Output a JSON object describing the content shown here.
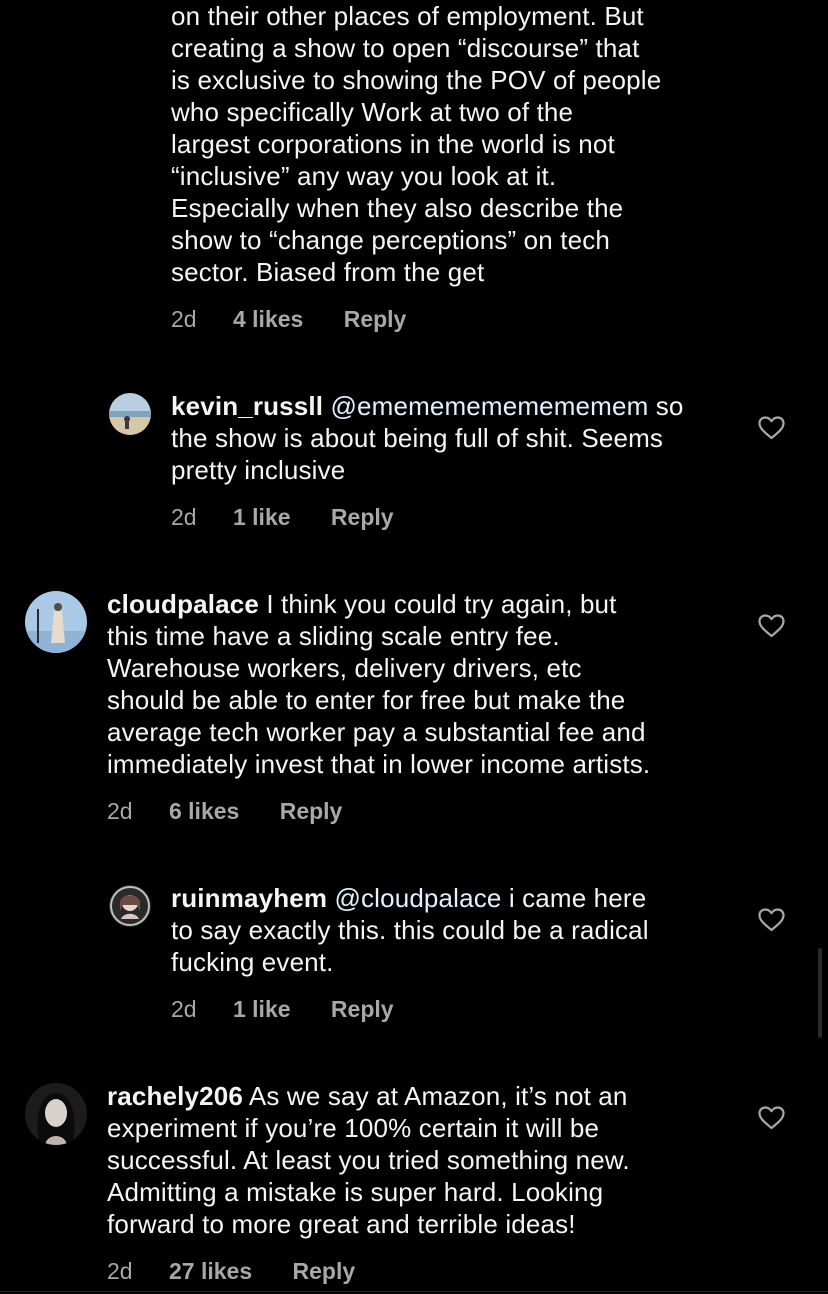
{
  "colors": {
    "background": "#000000",
    "text": "#f5f5f5",
    "meta": "#a8a8a8",
    "mention": "#e0f1ff",
    "heart_outline": "#a8a8a8"
  },
  "comments": [
    {
      "username": "",
      "mention": "",
      "lines": [
        "on their other places of employment. But",
        "creating a show to open “discourse” that",
        "is exclusive to showing the POV of people",
        "who specifically Work at two of the",
        "largest corporations in the world is not",
        "“inclusive” any way you look at it.",
        "Especially when they also describe the",
        "show to “change perceptions” on tech",
        "sector. Biased from the get"
      ],
      "time": "2d",
      "likes": "4 likes",
      "reply": "Reply"
    },
    {
      "username": "kevin_russll",
      "mention": "@emememememememem",
      "lines": [
        "so",
        "the show is about being full of shit. Seems",
        "pretty inclusive"
      ],
      "time": "2d",
      "likes": "1 like",
      "reply": "Reply",
      "heart_icon": "heart-outline-icon"
    },
    {
      "username": "cloudpalace",
      "mention": "",
      "lines": [
        "I think you could try again, but",
        "this time have a sliding scale entry fee.",
        "Warehouse workers, delivery drivers, etc",
        "should be able to enter for free but make the",
        "average tech worker pay a substantial fee and",
        "immediately invest that in lower income artists."
      ],
      "time": "2d",
      "likes": "6 likes",
      "reply": "Reply",
      "heart_icon": "heart-outline-icon"
    },
    {
      "username": "ruinmayhem",
      "mention": "@cloudpalace",
      "lines": [
        "i came here",
        "to say exactly this. this could be a radical",
        "fucking event."
      ],
      "time": "2d",
      "likes": "1 like",
      "reply": "Reply",
      "heart_icon": "heart-outline-icon"
    },
    {
      "username": "rachely206",
      "mention": "",
      "lines": [
        "As we say at Amazon, it’s not an",
        "experiment if you’re 100% certain it will be",
        "successful. At least you tried something new.",
        "Admitting a mistake is super hard. Looking",
        "forward to more great and terrible ideas!"
      ],
      "time": "2d",
      "likes": "27 likes",
      "reply": "Reply",
      "heart_icon": "heart-outline-icon"
    }
  ]
}
